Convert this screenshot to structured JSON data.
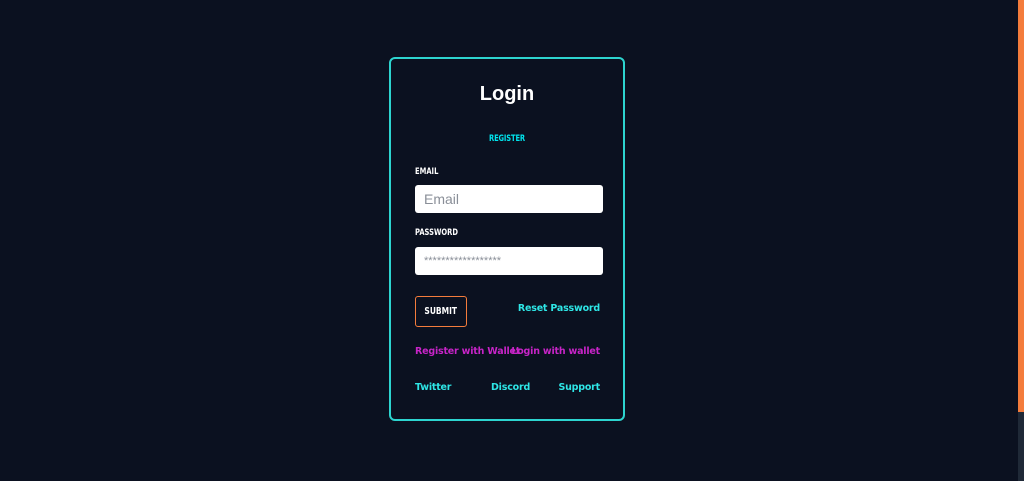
{
  "login": {
    "title": "Login",
    "register_label": "Register",
    "email_label": "Email",
    "email_placeholder": "Email",
    "password_label": "Password",
    "password_placeholder": "******************",
    "submit_label": "Submit",
    "reset_password_label": "Reset Password",
    "register_wallet_label": "Register with Wallet",
    "login_wallet_label": "Login with wallet"
  },
  "footer_links": {
    "twitter": "Twitter",
    "discord": "Discord",
    "support": "Support"
  },
  "colors": {
    "background": "#0b1120",
    "card_border": "#2dd4cf",
    "accent_cyan": "#2ee6e6",
    "accent_magenta": "#c724c7",
    "submit_border": "#f47c3c"
  }
}
